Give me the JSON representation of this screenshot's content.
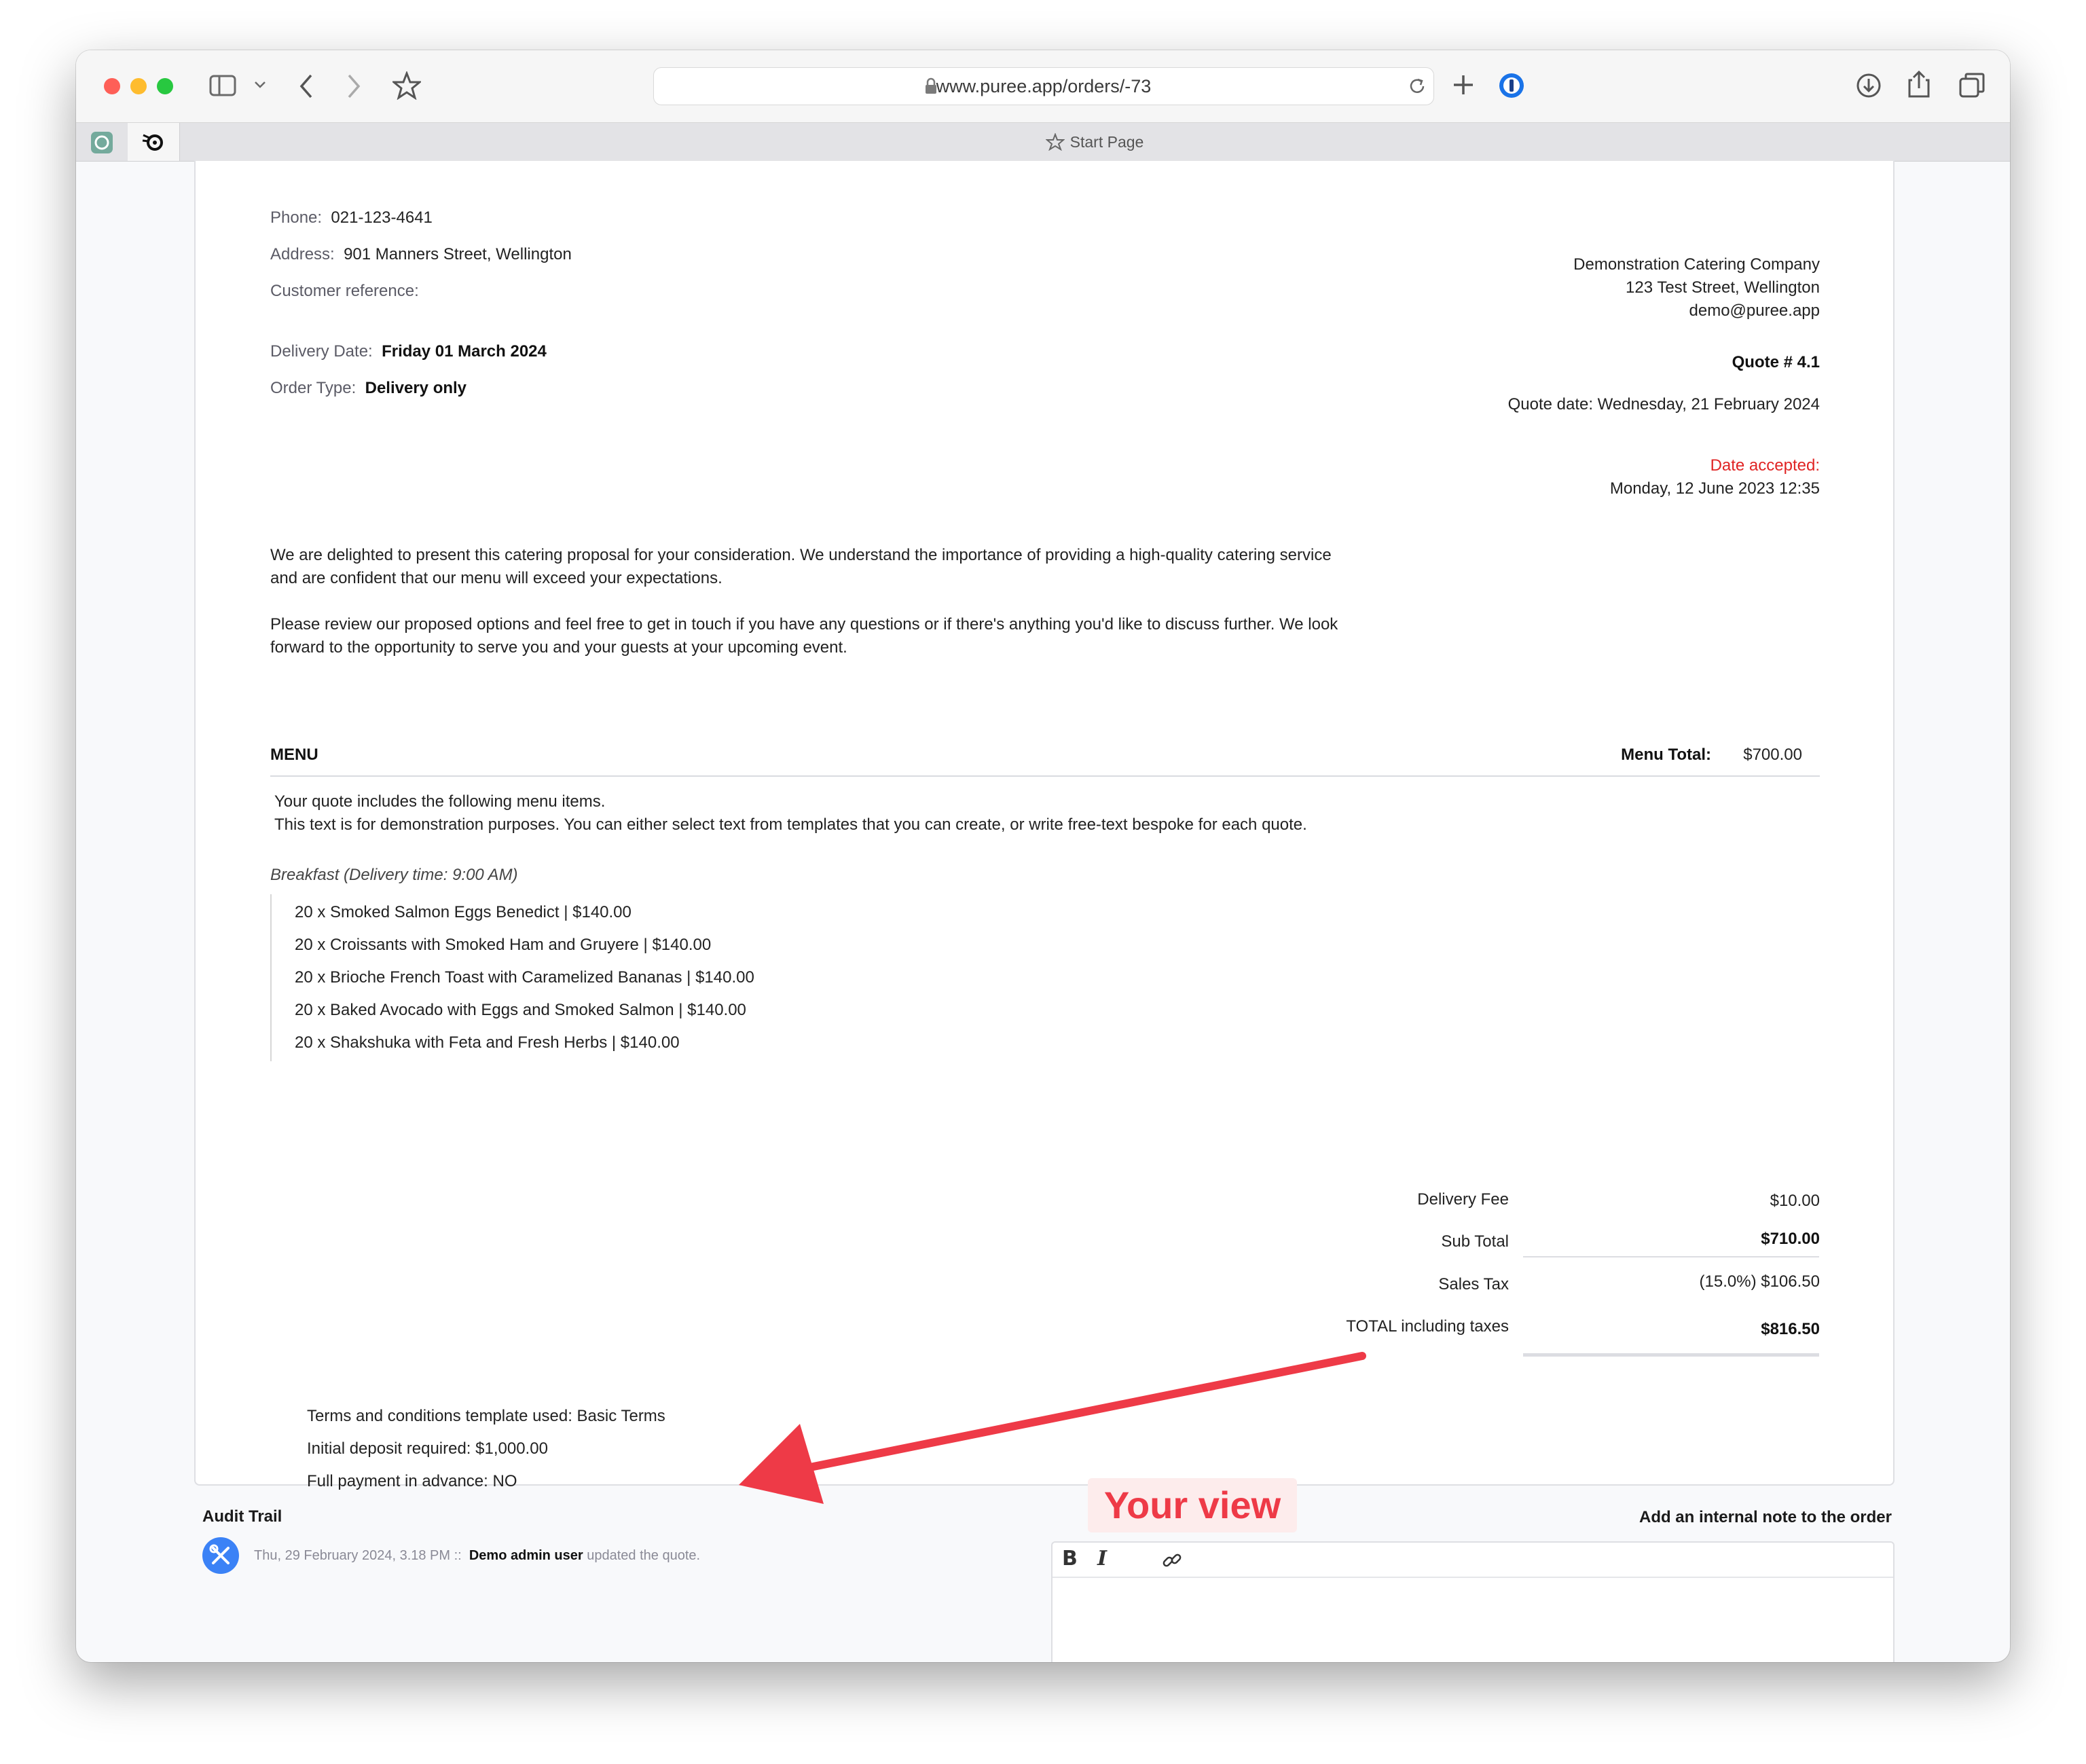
{
  "browser": {
    "url": "www.puree.app/orders/-73",
    "start_page": "Start Page"
  },
  "customer": {
    "phone_label": "Phone:",
    "phone": "021-123-4641",
    "address_label": "Address:",
    "address": "901 Manners Street, Wellington",
    "reference_label": "Customer reference:",
    "delivery_date_label": "Delivery Date:",
    "delivery_date": "Friday 01 March 2024",
    "order_type_label": "Order Type:",
    "order_type": "Delivery only"
  },
  "company": {
    "name": "Demonstration Catering Company",
    "street": "123 Test Street, Wellington",
    "email": "demo@puree.app",
    "quote_number": "Quote # 4.1",
    "quote_date": "Quote date: Wednesday, 21 February 2024",
    "accepted_label": "Date accepted:",
    "accepted_date": "Monday, 12 June 2023 12:35",
    "accepted_color": "#e02424"
  },
  "intro": {
    "p1_line1": "We are delighted to present this catering proposal for your consideration. We understand the importance of providing a high-quality catering service",
    "p1_line2": "and are confident that our menu will exceed your expectations.",
    "p2_line1": "Please review our proposed options and feel free to get in touch if you have any questions or if there's anything you'd like to discuss further. We look",
    "p2_line2": "forward to the opportunity to serve you and your guests at your upcoming event."
  },
  "menu": {
    "heading": "MENU",
    "total_label": "Menu Total:",
    "total": "$700.00",
    "desc_line1": "Your quote includes the following menu items.",
    "desc_line2": "This text is for demonstration purposes. You can either select text from templates that you can create, or write free-text bespoke for each quote.",
    "section": "Breakfast (Delivery time: 9:00 AM)",
    "items": [
      "20 x Smoked Salmon Eggs Benedict | $140.00",
      "20 x Croissants with Smoked Ham and Gruyere | $140.00",
      "20 x Brioche French Toast with Caramelized Bananas | $140.00",
      "20 x Baked Avocado with Eggs and Smoked Salmon | $140.00",
      "20 x Shakshuka with Feta and Fresh Herbs | $140.00"
    ]
  },
  "totals": {
    "delivery_label": "Delivery Fee",
    "delivery": "$10.00",
    "subtotal_label": "Sub Total",
    "subtotal": "$710.00",
    "tax_label": "Sales Tax",
    "tax": "(15.0%) $106.50",
    "total_label": "TOTAL including taxes",
    "total": "$816.50"
  },
  "terms": {
    "template": "Terms and conditions template used: Basic Terms",
    "deposit": "Initial deposit required: $1,000.00",
    "full_payment": "Full payment in advance: NO"
  },
  "annotation": {
    "label": "Your view",
    "color": "#ee3a47"
  },
  "audit": {
    "title": "Audit Trail",
    "timestamp": "Thu, 29 February 2024, 3.18 PM ::",
    "user": "Demo admin user",
    "action": "updated the quote."
  },
  "note": {
    "title": "Add an internal note to the order"
  },
  "icons": {
    "bold": "B",
    "italic": "I"
  }
}
